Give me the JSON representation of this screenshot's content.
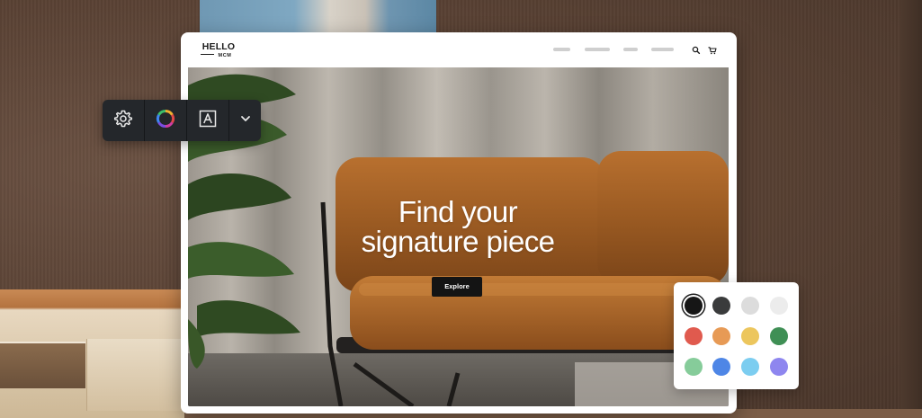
{
  "site": {
    "logo_top": "HELLO",
    "logo_bottom": "MCM",
    "nav_items": [
      "",
      "",
      "",
      ""
    ],
    "search_icon": "search-icon",
    "cart_icon": "cart-icon"
  },
  "hero": {
    "title_line1": "Find your",
    "title_line2": "signature piece",
    "cta_label": "Explore"
  },
  "toolbar": {
    "items": [
      {
        "icon": "gear-icon"
      },
      {
        "icon": "color-wheel-icon"
      },
      {
        "icon": "font-icon"
      },
      {
        "icon": "chevron-down-icon"
      }
    ]
  },
  "palette": {
    "selected_index": 0,
    "colors": [
      "#161616",
      "#3a3b3c",
      "#dcdcdc",
      "#ececec",
      "#e05a4e",
      "#e79a55",
      "#ecc65d",
      "#3f8f55",
      "#86cc9a",
      "#4e86e6",
      "#7ccdf0",
      "#8e86ef"
    ]
  }
}
